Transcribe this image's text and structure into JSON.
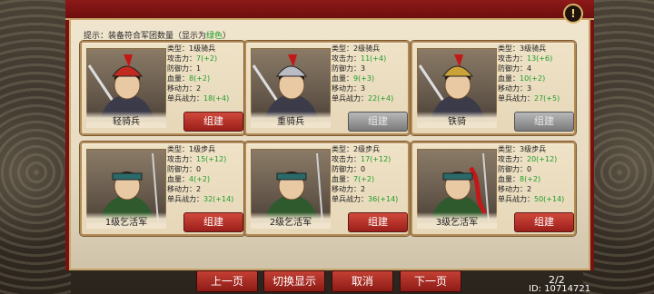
{
  "tip": {
    "prefix": "提示：装备符合军团数量（显示为",
    "highlight": "绿色",
    "suffix": "）"
  },
  "alert_icon": "exclamation-icon",
  "units": [
    {
      "name": "轻骑兵",
      "type": "类型：1级骑兵",
      "attack_label": "攻击力：",
      "attack": "7(+2)",
      "defense": "防御力：1",
      "hp_label": "血量：",
      "hp": "8(+2)",
      "move": "移动力：2",
      "power_label": "单兵战力：",
      "power": "18(+4)",
      "button": "组建",
      "button_state": "enabled",
      "helmet": "red"
    },
    {
      "name": "重骑兵",
      "type": "类型：2级骑兵",
      "attack_label": "攻击力：",
      "attack": "11(+4)",
      "defense": "防御力：3",
      "hp_label": "血量：",
      "hp": "9(+3)",
      "move": "移动力：3",
      "power_label": "单兵战力：",
      "power": "22(+4)",
      "button": "组建",
      "button_state": "disabled",
      "helmet": "silver"
    },
    {
      "name": "铁骑",
      "type": "类型：3级骑兵",
      "attack_label": "攻击力：",
      "attack": "13(+6)",
      "defense": "防御力：4",
      "hp_label": "血量：",
      "hp": "10(+2)",
      "move": "移动力：3",
      "power_label": "单兵战力：",
      "power": "27(+5)",
      "button": "组建",
      "button_state": "disabled",
      "helmet": "gold"
    },
    {
      "name": "1级乞活军",
      "type": "类型：1级步兵",
      "attack_label": "攻击力：",
      "attack": "15(+12)",
      "defense": "防御力：0",
      "hp_label": "血量：",
      "hp": "4(+2)",
      "move": "移动力：2",
      "power_label": "单兵战力：",
      "power": "32(+14)",
      "button": "组建",
      "button_state": "enabled",
      "helmet": "band"
    },
    {
      "name": "2级乞活军",
      "type": "类型：2级步兵",
      "attack_label": "攻击力：",
      "attack": "17(+12)",
      "defense": "防御力：0",
      "hp_label": "血量：",
      "hp": "7(+2)",
      "move": "移动力：2",
      "power_label": "单兵战力：",
      "power": "36(+14)",
      "button": "组建",
      "button_state": "enabled",
      "helmet": "band"
    },
    {
      "name": "3级乞活军",
      "type": "类型：3级步兵",
      "attack_label": "攻击力：",
      "attack": "20(+12)",
      "defense": "防御力：0",
      "hp_label": "血量：",
      "hp": "8(+2)",
      "move": "移动力：2",
      "power_label": "单兵战力：",
      "power": "50(+14)",
      "button": "组建",
      "button_state": "enabled",
      "helmet": "band-red"
    }
  ],
  "bottom_buttons": {
    "prev": "上一页",
    "toggle": "切换显示",
    "cancel": "取消",
    "next": "下一页"
  },
  "page_indicator": "2/2",
  "id_text": "ID: 10714721",
  "colors": {
    "accent_red": "#8c1a18",
    "highlight_green": "#1f9d2a",
    "gold_border": "#b28a55"
  }
}
